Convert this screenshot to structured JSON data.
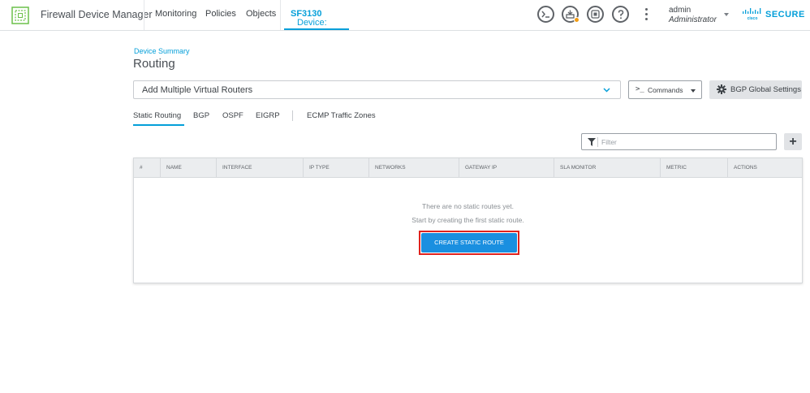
{
  "header": {
    "app_title": "Firewall Device Manager",
    "nav": [
      "Monitoring",
      "Policies",
      "Objects"
    ],
    "device_prefix": "Device:",
    "device_name": "SF3130",
    "icons": [
      "cli-console-icon",
      "deployment-icon",
      "api-explorer-icon",
      "help-icon",
      "more-options-icon"
    ],
    "user_name": "admin",
    "user_role": "Administrator",
    "brand": "SECURE"
  },
  "page": {
    "breadcrumb": "Device Summary",
    "title": "Routing"
  },
  "toolbar": {
    "virtual_router_value": "Add Multiple Virtual Routers",
    "commands_label": "Commands",
    "bgp_global_label": "BGP Global Settings"
  },
  "tabs": [
    "Static Routing",
    "BGP",
    "OSPF",
    "EIGRP",
    "ECMP Traffic Zones"
  ],
  "active_tab": "Static Routing",
  "filter": {
    "placeholder": "Filter"
  },
  "add_button_label": "+",
  "table": {
    "columns": [
      "#",
      "NAME",
      "INTERFACE",
      "IP TYPE",
      "NETWORKS",
      "GATEWAY IP",
      "SLA MONITOR",
      "METRIC",
      "ACTIONS"
    ],
    "rows": [],
    "empty_line_1": "There are no static routes yet.",
    "empty_line_2": "Start by creating the first static route.",
    "create_button": "CREATE STATIC ROUTE"
  },
  "colors": {
    "accent": "#049fd9",
    "primary_button": "#1a8fe0",
    "highlight_outline": "#e0231e",
    "badge": "#f39c12"
  }
}
